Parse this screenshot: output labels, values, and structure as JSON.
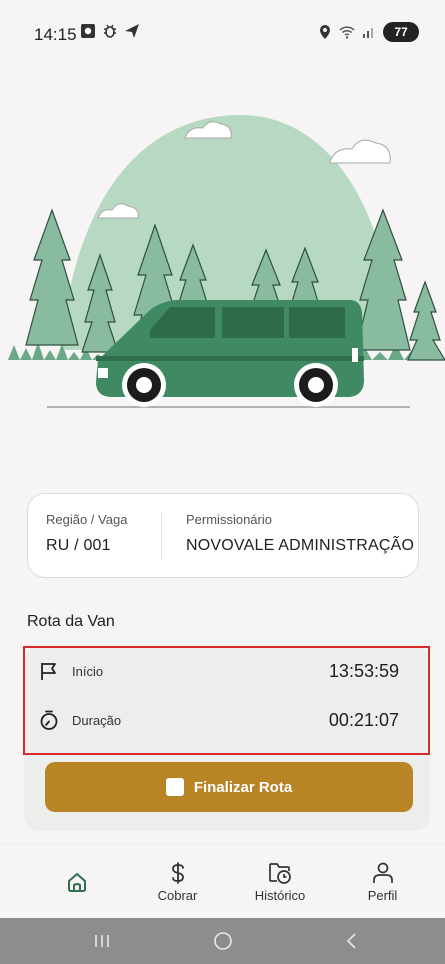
{
  "status_bar": {
    "time": "14:15",
    "battery": "77",
    "left_icons": [
      "gallery-icon",
      "bug-icon",
      "send-icon"
    ],
    "right_icons": [
      "location-icon",
      "wifi-icon",
      "signal-icon"
    ]
  },
  "info": {
    "region_label": "Região / Vaga",
    "region_value": "RU / 001",
    "permit_label": "Permissionário",
    "permit_value": "NOVOVALE ADMINISTRAÇÃO"
  },
  "route": {
    "title": "Rota da Van",
    "start_label": "Início",
    "start_value": "13:53:59",
    "duration_label": "Duração",
    "duration_value": "00:21:07",
    "finish_label": "Finalizar Rota"
  },
  "nav": {
    "items": [
      {
        "label": "",
        "icon": "home-icon"
      },
      {
        "label": "Cobrar",
        "icon": "dollar-icon"
      },
      {
        "label": "Histórico",
        "icon": "history-icon"
      },
      {
        "label": "Perfil",
        "icon": "user-icon"
      }
    ]
  },
  "colors": {
    "accent_green": "#3f8a62",
    "button_gold": "#b98426",
    "highlight_red": "#d82a2a"
  }
}
